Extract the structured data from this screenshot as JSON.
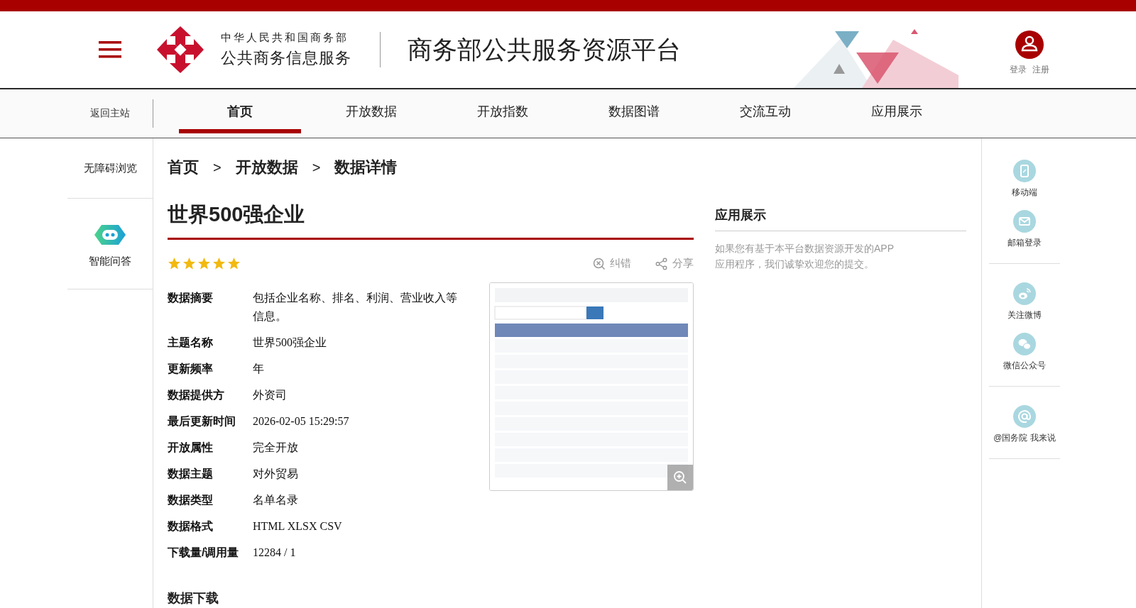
{
  "header": {
    "logo_line1": "中华人民共和国商务部",
    "logo_line2": "公共商务信息服务",
    "title": "商务部公共服务资源平台",
    "user_links": [
      "登录",
      "注册"
    ]
  },
  "nav": {
    "back_link": "返回主站",
    "tabs": [
      {
        "label": "首页",
        "selected": true
      },
      {
        "label": "开放数据",
        "selected": false
      },
      {
        "label": "开放指数",
        "selected": false
      },
      {
        "label": "数据图谱",
        "selected": false
      },
      {
        "label": "交流互动",
        "selected": false
      },
      {
        "label": "应用展示",
        "selected": false
      }
    ]
  },
  "left_tools": [
    {
      "label": "无障碍浏览",
      "kind": "text"
    },
    {
      "label": "智能问答",
      "kind": "robot"
    }
  ],
  "breadcrumb": {
    "items": [
      "首页",
      "开放数据",
      "数据详情"
    ],
    "separators": [
      ">",
      ">"
    ]
  },
  "dataset": {
    "title": "世界500强企业",
    "stars": 5,
    "actions": [
      {
        "label": "纠错",
        "kind": "report"
      },
      {
        "label": "分享",
        "kind": "share"
      }
    ],
    "fields": [
      {
        "label": "数据摘要",
        "value": "包括企业名称、排名、利润、营业收入等信息。"
      },
      {
        "label": "主题名称",
        "value": "世界500强企业"
      },
      {
        "label": "更新频率",
        "value": "年"
      },
      {
        "label": "数据提供方",
        "value": "外资司"
      },
      {
        "label": "最后更新时间",
        "value": "2026-02-05 15:29:57"
      },
      {
        "label": "开放属性",
        "value": "完全开放"
      },
      {
        "label": "数据主题",
        "value": "对外贸易"
      },
      {
        "label": "数据类型",
        "value": "名单名录"
      },
      {
        "label": "数据格式",
        "value": "HTML XLSX CSV"
      },
      {
        "label": "下载量/调用量",
        "value": "12284 / 1"
      }
    ],
    "download_heading": "数据下载"
  },
  "app_showcase": {
    "title": "应用展示",
    "text": "如果您有基于本平台数据资源开发的APP应用程序，我们诚挚欢迎您的提交。"
  },
  "side_links": {
    "groups": [
      {
        "items": [
          {
            "label": "移动端",
            "kind": "mobile"
          },
          {
            "label": "邮箱登录",
            "kind": "mail"
          }
        ]
      },
      {
        "items": [
          {
            "label": "关注微博",
            "kind": "weibo"
          },
          {
            "label": "微信公众号",
            "kind": "wechat"
          }
        ]
      },
      {
        "items": [
          {
            "label": "@国务院 我来说",
            "kind": "at"
          }
        ]
      }
    ]
  }
}
